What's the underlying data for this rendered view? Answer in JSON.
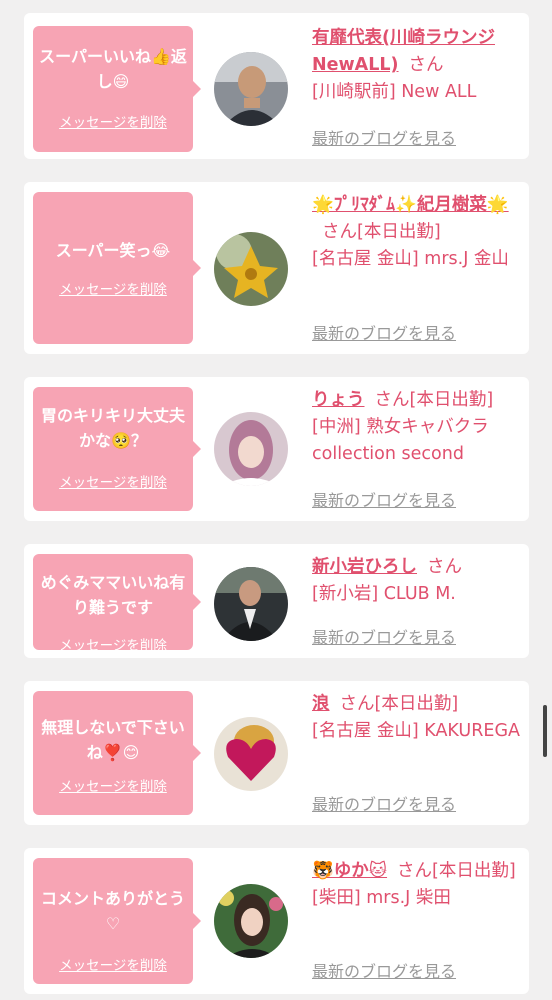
{
  "colors": {
    "accent": "#e0506e",
    "bubble": "#f7a4b4",
    "muted": "#999999",
    "background": "#f1f0f0"
  },
  "delete_label": "メッセージを削除",
  "blog_label": "最新のブログを見る",
  "items": [
    {
      "message": "スーパーいいね👍返し😄",
      "name": "有靡代表(川崎ラウンジNewALL)",
      "suffix": "さん",
      "location": "[川崎駅前] New ALL",
      "avatar_icon": "man-photo-avatar"
    },
    {
      "message": "スーパー笑っ😂",
      "name": "🌟ﾌﾟﾘﾏﾀﾞﾑ✨紀月樹菜🌟",
      "suffix": "さん[本日出勤]",
      "location": "[名古屋 金山] mrs.J 金山",
      "avatar_icon": "flower-photo-avatar"
    },
    {
      "message": "胃のキリキリ大丈夫かな🥺？",
      "name": "りょう",
      "suffix": "さん[本日出勤]",
      "location": "[中洲] 熟女キャバクラ collection second",
      "avatar_icon": "woman-photo-avatar"
    },
    {
      "message": "めぐみママいいね有り難うです",
      "name": "新小岩ひろし",
      "suffix": "さん",
      "location": "[新小岩] CLUB M.",
      "avatar_icon": "man-suit-photo-avatar"
    },
    {
      "message": "無理しないで下さいね❣️😊",
      "name": "浪",
      "suffix": "さん[本日出勤]",
      "location": "[名古屋 金山] KAKUREGA",
      "avatar_icon": "heart-photo-avatar"
    },
    {
      "message": "コメントありがとう♡",
      "name": "🐯ゆか🐱",
      "suffix": "さん[本日出勤]",
      "location": "[柴田] mrs.J 柴田",
      "avatar_icon": "woman-garden-photo-avatar"
    }
  ]
}
